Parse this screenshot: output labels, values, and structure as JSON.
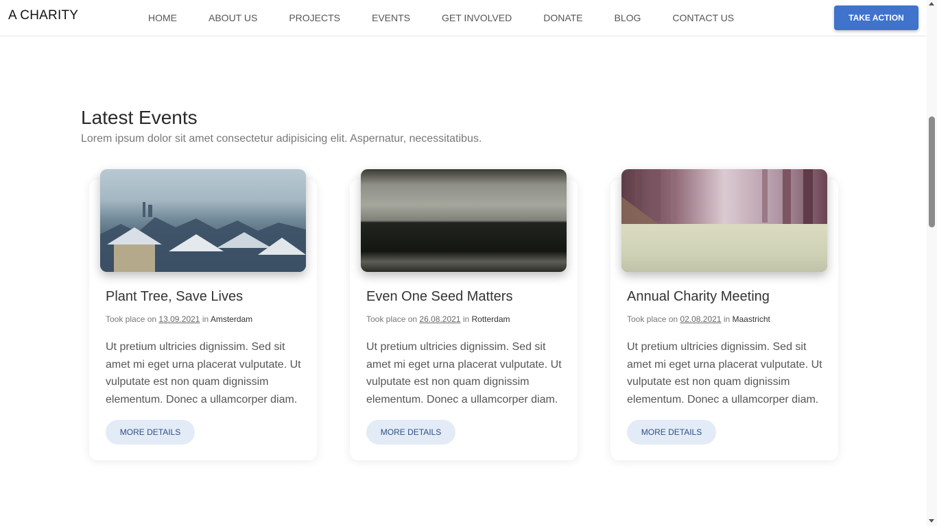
{
  "nav": {
    "brand": "A CHARITY",
    "links": [
      "HOME",
      "ABOUT US",
      "PROJECTS",
      "EVENTS",
      "GET INVOLVED",
      "DONATE",
      "BLOG",
      "CONTACT US"
    ],
    "cta": "TAKE ACTION"
  },
  "section": {
    "title": "Latest Events",
    "subtitle": "Lorem ipsum dolor sit amet consectetur adipisicing elit. Aspernatur, necessitatibus."
  },
  "events": [
    {
      "title": "Plant Tree, Save Lives",
      "meta_prefix": "Took place on",
      "date": "13.09.2021",
      "meta_in": "in",
      "location": "Amsterdam",
      "text": "Ut pretium ultricies dignissim. Sed sit amet mi eget urna placerat vulputate. Ut vulputate est non quam dignissim elementum. Donec a ullamcorper diam.",
      "button": "MORE DETAILS"
    },
    {
      "title": "Even One Seed Matters",
      "meta_prefix": "Took place on",
      "date": "26.08.2021",
      "meta_in": "in",
      "location": "Rotterdam",
      "text": "Ut pretium ultricies dignissim. Sed sit amet mi eget urna placerat vulputate. Ut vulputate est non quam dignissim elementum. Donec a ullamcorper diam.",
      "button": "MORE DETAILS"
    },
    {
      "title": "Annual Charity Meeting",
      "meta_prefix": "Took place on",
      "date": "02.08.2021",
      "meta_in": "in",
      "location": "Maastricht",
      "text": "Ut pretium ultricies dignissim. Sed sit amet mi eget urna placerat vulputate. Ut vulputate est non quam dignissim elementum. Donec a ullamcorper diam.",
      "button": "MORE DETAILS"
    }
  ],
  "colors": {
    "accent": "#3f73cc",
    "button_soft": "#e3ebf7"
  }
}
